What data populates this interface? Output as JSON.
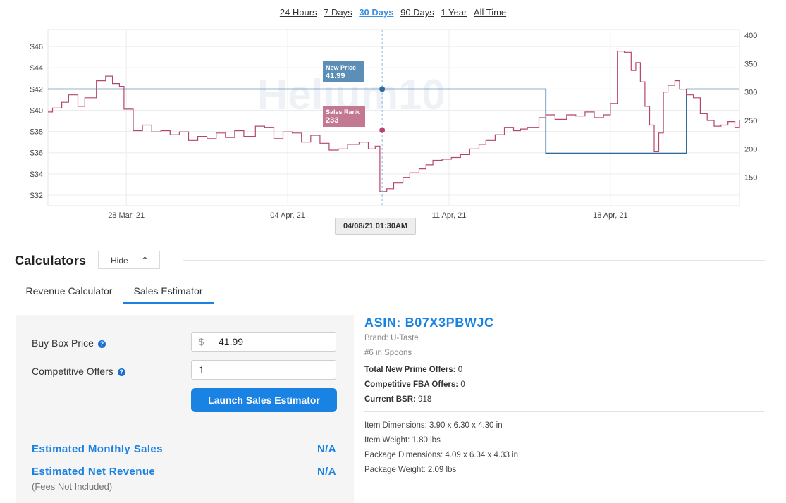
{
  "range_tabs": [
    {
      "label": "24 Hours",
      "active": false
    },
    {
      "label": "7 Days",
      "active": false
    },
    {
      "label": "30 Days",
      "active": true
    },
    {
      "label": "90 Days",
      "active": false
    },
    {
      "label": "1 Year",
      "active": false
    },
    {
      "label": "All Time",
      "active": false
    }
  ],
  "chart_data": {
    "type": "line",
    "title": "",
    "watermark": "Helium10",
    "x_tick_labels": [
      "28 Mar, 21",
      "04 Apr, 21",
      "11 Apr, 21",
      "18 Apr, 21"
    ],
    "y_left_tick_labels": [
      "$32",
      "$34",
      "$36",
      "$38",
      "$40",
      "$42",
      "$44",
      "$46"
    ],
    "y_left_range": [
      31,
      47.6
    ],
    "y_right_tick_labels": [
      "150",
      "200",
      "250",
      "300",
      "350",
      "400"
    ],
    "y_right_range": [
      100,
      410
    ],
    "x_range_days": [
      -3.4,
      26.6
    ],
    "grid": true,
    "series": [
      {
        "name": "New Price",
        "axis": "left",
        "color": "#2f6a9a",
        "points": [
          [
            -3.4,
            41.99
          ],
          [
            18.2,
            41.99
          ],
          [
            18.2,
            35.95
          ],
          [
            24.3,
            35.95
          ],
          [
            24.3,
            41.99
          ],
          [
            26.6,
            41.99
          ]
        ]
      },
      {
        "name": "Sales Rank",
        "axis": "right",
        "color": "#b5466e",
        "points": [
          [
            -3.4,
            265
          ],
          [
            -3.2,
            272
          ],
          [
            -2.8,
            282
          ],
          [
            -2.5,
            295
          ],
          [
            -2.1,
            275
          ],
          [
            -1.8,
            290
          ],
          [
            -1.3,
            320
          ],
          [
            -0.9,
            328
          ],
          [
            -0.6,
            315
          ],
          [
            -0.3,
            310
          ],
          [
            -0.1,
            270
          ],
          [
            0.3,
            232
          ],
          [
            0.7,
            242
          ],
          [
            1.1,
            230
          ],
          [
            1.5,
            232
          ],
          [
            1.9,
            225
          ],
          [
            2.3,
            230
          ],
          [
            2.7,
            215
          ],
          [
            3.1,
            222
          ],
          [
            3.5,
            218
          ],
          [
            3.9,
            228
          ],
          [
            4.3,
            220
          ],
          [
            4.7,
            232
          ],
          [
            5.1,
            222
          ],
          [
            5.6,
            240
          ],
          [
            6.0,
            238
          ],
          [
            6.4,
            218
          ],
          [
            6.8,
            230
          ],
          [
            7.2,
            228
          ],
          [
            7.6,
            212
          ],
          [
            8.0,
            224
          ],
          [
            8.4,
            210
          ],
          [
            8.8,
            198
          ],
          [
            9.2,
            200
          ],
          [
            9.6,
            208
          ],
          [
            10.1,
            212
          ],
          [
            10.5,
            200
          ],
          [
            10.8,
            205
          ],
          [
            11.0,
            125
          ],
          [
            11.3,
            130
          ],
          [
            11.6,
            140
          ],
          [
            12.0,
            150
          ],
          [
            12.3,
            158
          ],
          [
            12.7,
            165
          ],
          [
            13.0,
            172
          ],
          [
            13.3,
            180
          ],
          [
            13.7,
            182
          ],
          [
            14.1,
            185
          ],
          [
            14.5,
            190
          ],
          [
            14.9,
            200
          ],
          [
            15.3,
            208
          ],
          [
            15.6,
            215
          ],
          [
            16.0,
            225
          ],
          [
            16.4,
            238
          ],
          [
            16.8,
            232
          ],
          [
            17.1,
            235
          ],
          [
            17.4,
            238
          ],
          [
            17.9,
            255
          ],
          [
            18.2,
            260
          ],
          [
            18.6,
            252
          ],
          [
            19.1,
            260
          ],
          [
            19.5,
            258
          ],
          [
            19.9,
            265
          ],
          [
            20.3,
            255
          ],
          [
            20.7,
            260
          ],
          [
            21.0,
            280
          ],
          [
            21.3,
            372
          ],
          [
            21.6,
            370
          ],
          [
            21.9,
            338
          ],
          [
            22.1,
            352
          ],
          [
            22.3,
            318
          ],
          [
            22.5,
            275
          ],
          [
            22.7,
            242
          ],
          [
            22.9,
            195
          ],
          [
            23.1,
            228
          ],
          [
            23.3,
            300
          ],
          [
            23.5,
            312
          ],
          [
            23.8,
            320
          ],
          [
            24.0,
            305
          ],
          [
            24.3,
            295
          ],
          [
            24.6,
            290
          ],
          [
            24.9,
            262
          ],
          [
            25.2,
            250
          ],
          [
            25.5,
            240
          ],
          [
            25.8,
            242
          ],
          [
            26.1,
            248
          ],
          [
            26.4,
            238
          ],
          [
            26.6,
            250
          ]
        ]
      }
    ],
    "hover": {
      "date_label": "04/08/21 01:30AM",
      "price_label": "New Price",
      "price_value": "41.99",
      "rank_label": "Sales Rank",
      "rank_value": "233"
    }
  },
  "calculators": {
    "title": "Calculators",
    "hide_label": "Hide",
    "chevron_glyph": "⌃",
    "tabs": [
      {
        "label": "Revenue Calculator",
        "active": false
      },
      {
        "label": "Sales Estimator",
        "active": true
      }
    ],
    "buy_box_label": "Buy Box Price",
    "currency_symbol": "$",
    "buy_box_value": "41.99",
    "offers_label": "Competitive Offers",
    "offers_value": "1",
    "launch_label": "Launch Sales Estimator",
    "monthly_sales_label": "Estimated Monthly Sales",
    "monthly_sales_value": "N/A",
    "net_revenue_label": "Estimated Net Revenue",
    "net_revenue_value": "N/A",
    "fees_note": "(Fees Not Included)"
  },
  "product": {
    "asin_label": "ASIN: B07X3PBWJC",
    "brand": "Brand: U-Taste",
    "rank_category": "#6 in Spoons",
    "prime_offers_label": "Total New Prime Offers:",
    "prime_offers_value": "0",
    "fba_offers_label": "Competitive FBA Offers:",
    "fba_offers_value": "0",
    "bsr_label": "Current BSR:",
    "bsr_value": "918",
    "item_dimensions": "Item Dimensions: 3.90 x 6.30 x 4.30 in",
    "item_weight": "Item Weight: 1.80 lbs",
    "package_dimensions": "Package Dimensions: 4.09 x 6.34 x 4.33 in",
    "package_weight": "Package Weight: 2.09 lbs"
  }
}
